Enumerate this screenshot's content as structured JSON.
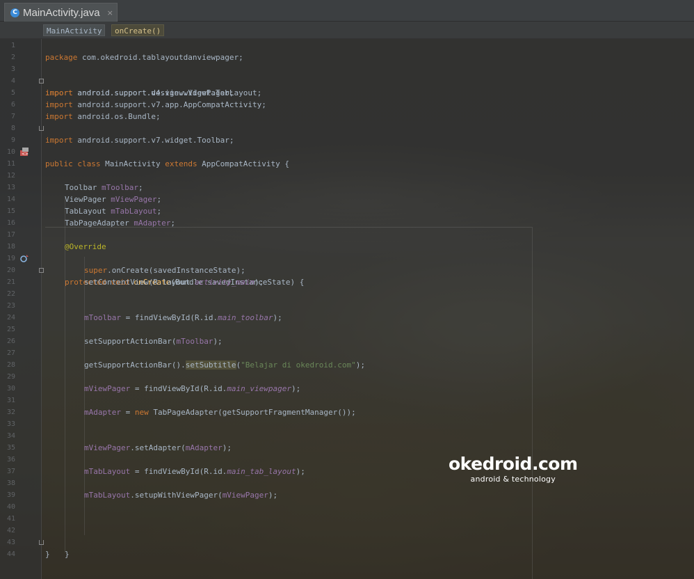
{
  "tab": {
    "title": "MainActivity.java",
    "close": "×"
  },
  "breadcrumb": [
    "MainActivity",
    "onCreate()"
  ],
  "code": {
    "l1_kw": "package",
    "l1_rest": " com.okedroid.tablayoutdanviewpager;",
    "l3_kw": "import",
    "l3_rest": " android.support.design.widget.TabLayout;",
    "l4_kw": "import",
    "l4_rest": " android.support.v4.view.ViewPager;",
    "l5_kw": "import",
    "l5_rest": " android.support.v7.app.AppCompatActivity;",
    "l6_kw": "import",
    "l6_rest": " android.os.Bundle;",
    "l7_kw": "import",
    "l7_rest": " android.support.v7.widget.Toolbar;",
    "l9_kw1": "public class",
    "l9_mid": " MainActivity ",
    "l9_kw2": "extends",
    "l9_rest": " AppCompatActivity {",
    "l12_type": "Toolbar ",
    "l12_field": "mToolbar",
    "l12_end": ";",
    "l13_type": "ViewPager ",
    "l13_field": "mViewPager",
    "l13_end": ";",
    "l14_type": "TabLayout ",
    "l14_field": "mTabLayout",
    "l14_end": ";",
    "l15_type": "TabPageAdapter ",
    "l15_field": "mAdapter",
    "l15_end": ";",
    "l17_ann": "@Override",
    "l18_kw": "protected void ",
    "l18_fn": "onCreate",
    "l18_rest": "(Bundle savedInstanceState) {",
    "l19_kw": "super",
    "l19_rest": ".onCreate(savedInstanceState);",
    "l20_a": "setContentView(R.layout.",
    "l20_it": "activity_main",
    "l20_b": ");",
    "l23_f": "mToolbar",
    "l23_a": " = findViewById(R.id.",
    "l23_it": "main_toolbar",
    "l23_b": ");",
    "l25_a": "setSupportActionBar(",
    "l25_f": "mToolbar",
    "l25_b": ");",
    "l27_a": "getSupportActionBar().",
    "l27_hl": "setSubtitle",
    "l27_b": "(",
    "l27_str": "\"Belajar di okedroid.com\"",
    "l27_c": ");",
    "l29_f": "mViewPager",
    "l29_a": " = findViewById(R.id.",
    "l29_it": "main_viewpager",
    "l29_b": ");",
    "l31_f": "mAdapter",
    "l31_a": " = ",
    "l31_kw": "new",
    "l31_b": " TabPageAdapter(getSupportFragmentManager());",
    "l34_f": "mViewPager",
    "l34_a": ".setAdapter(",
    "l34_f2": "mAdapter",
    "l34_b": ");",
    "l36_f": "mTabLayout",
    "l36_a": " = findViewById(R.id.",
    "l36_it": "main_tab_layout",
    "l36_b": ");",
    "l38_f": "mTabLayout",
    "l38_a": ".setupWithViewPager(",
    "l38_f2": "mViewPager",
    "l38_b": ");",
    "l42": "}",
    "l43": "}"
  },
  "line_numbers": [
    "1",
    "2",
    "3",
    "4",
    "5",
    "6",
    "7",
    "8",
    "9",
    "10",
    "11",
    "12",
    "13",
    "14",
    "15",
    "16",
    "17",
    "18",
    "19",
    "20",
    "21",
    "22",
    "23",
    "24",
    "25",
    "26",
    "27",
    "28",
    "29",
    "30",
    "31",
    "32",
    "33",
    "34",
    "35",
    "36",
    "37",
    "38",
    "39",
    "40",
    "41",
    "42",
    "43",
    "44"
  ],
  "watermark": {
    "main": "okedroid.com",
    "sub": "android & technology"
  },
  "colors": {
    "keyword": "#cc7832",
    "field": "#9876aa",
    "annotation": "#bbb529",
    "method_decl": "#ffc66d",
    "string": "#6a8759",
    "text": "#a9b7c6",
    "line_number": "#606366"
  },
  "icons": [
    "java-class-icon",
    "implementing-class-icon",
    "override-method-icon"
  ]
}
